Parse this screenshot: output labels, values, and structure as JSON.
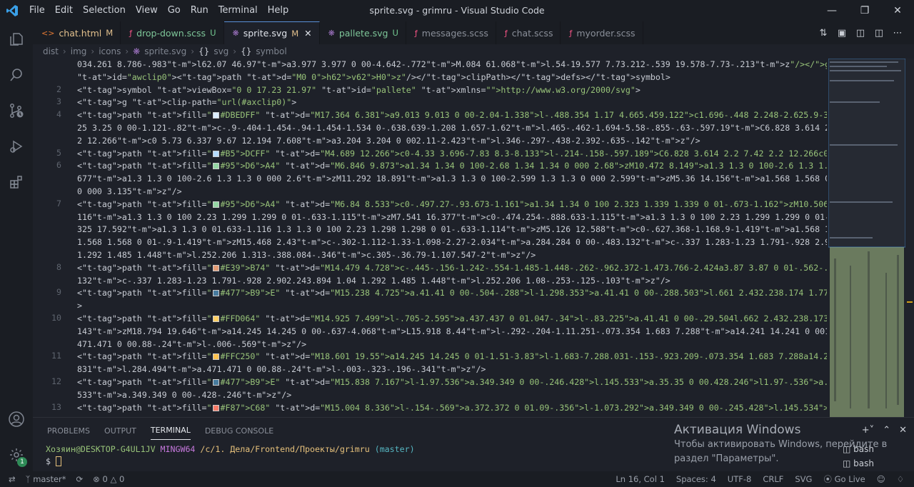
{
  "menu": [
    "File",
    "Edit",
    "Selection",
    "View",
    "Go",
    "Run",
    "Terminal",
    "Help"
  ],
  "window_title": "sprite.svg - grimru - Visual Studio Code",
  "tabs": [
    {
      "label": "chat.html",
      "status": "M",
      "icon": "html-icon",
      "color": "#e37933",
      "active": false
    },
    {
      "label": "drop-down.scss",
      "status": "U",
      "icon": "scss-icon",
      "color": "#f55385",
      "active": false
    },
    {
      "label": "sprite.svg",
      "status": "M",
      "icon": "svg-icon",
      "color": "#a074c4",
      "active": true
    },
    {
      "label": "pallete.svg",
      "status": "U",
      "icon": "svg-icon",
      "color": "#a074c4",
      "active": false
    },
    {
      "label": "messages.scss",
      "status": "",
      "icon": "scss-icon",
      "color": "#f55385",
      "active": false
    },
    {
      "label": "chat.scss",
      "status": "",
      "icon": "scss-icon",
      "color": "#f55385",
      "active": false
    },
    {
      "label": "myorder.scss",
      "status": "",
      "icon": "scss-icon",
      "color": "#f55385",
      "active": false
    }
  ],
  "breadcrumbs": [
    "dist",
    "img",
    "icons",
    "sprite.svg",
    "svg",
    "symbol"
  ],
  "line_numbers": [
    "",
    "",
    "2",
    "3",
    "4",
    "",
    "",
    "5",
    "6",
    "",
    "",
    "7",
    "",
    "",
    "",
    "",
    "8",
    "",
    "9",
    "",
    "10",
    "",
    "",
    "11",
    "",
    "12",
    "",
    "13"
  ],
  "code_lines": [
    "034.261 8.786-.983l62.07 46.97a3.977 3.977 0 00-4.642-.772M.084 61.068l.54-19.577 7.73.212-.539 19.578-7.73-.213z\"/></g></defs><clipPath",
    "id=\"awclip0\"><path d=\"M0 0h62v62H0z\"/></clipPath></defs></symbol>",
    "<symbol viewBox=\"0 0 17.23 21.97\" id=\"pallete\" xmlns=\"http://www.w3.org/2000/svg\">",
    "<g clip-path=\"url(#axclip0)\">",
    "<path fill=\"#DBEDFF\" d=\"M17.364 6.381a9.013 9.013 0 00-2.04-1.338l-.488.354 1.17 4.665.459.122c1.696-.448 2.248-2.625.9-3.803zm-1.587 8.239a3.",
    "25 3.25 0 00-1.121-.82c-.9-.404-1.454-.94-1.454-1.534 0-.638.639-1.208 1.657-1.62l.465-.462-1.694-5.58-.855-.63-.597.19C6.828 3.614 2.2 7.42 2.",
    "2 12.266c0 5.73 6.337 9.67 12.194 7.608a3.204 3.204 0 002.11-2.423l.346-.297-.438-2.392-.635-.142z\"/>",
    "<path fill=\"#B5DCFF\" d=\"M4.689 12.266c0-4.33 3.696-7.83 8.3-8.133l-.214-.158-.597.189C6.828 3.614 2.2 7.42 2.2 12.266c0 5.084 4.99 8.76 10.206",
    "<path fill=\"#95D6A4\" d=\"M6.846 9.873a1.34 1.34 0 100-2.68 1.34 1.34 0 000 2.68zM10.472 8.149a1.3 1.3 0 100-2.6 1.3 1.3 0 000 2.6zM7.507 17.",
    "677a1.3 1.3 0 100-2.6 1.3 1.3 0 000 2.6zM11.292 18.891a1.3 1.3 0 100-2.599 1.3 1.3 0 000 2.599zM5.36 14.156a1.568 1.568 0 100-3.135 1.568 1.568",
    "0 000 3.135z\"/>",
    "<path fill=\"#95D6A4\" d=\"M6.84 8.533c0-.497.27-.93.673-1.161a1.34 1.34 0 100 2.323 1.339 1.339 0 01-.673-1.162zM10.506 6.85c0-.475.254-.89.633-1",
    "116a1.3 1.3 0 100 2.23 1.299 1.299 0 01-.633-1.115zM7.541 16.377c0-.474.254-.888.633-1.115a1.3 1.3 0 100 2.23 1.299 1.299 0 01-.633-1.115zM11.",
    "325 17.592a1.3 1.3 0 01.633-1.116 1.3 1.3 0 100 2.23 1.298 1.298 0 01-.633-1.114zM5.126 12.588c0-.627.368-1.168.9-1.419a1.568 1.568 0 100 2.838",
    "1.568 1.568 0 01-.9-1.419zM15.468 2.43c-.302-1.112-1.33-1.098-2.27-2.034a.284.284 0 00-.483.132c-.337 1.283-1.23 1.791-.928 2.902.243.894 1.04",
    "1.292 1.485 1.448l.252.206 1.313-.388.084-.346c.305-.36.79-1.107.547-2z\"/>",
    "<path fill=\"#E39B74\" d=\"M14.479 4.728c-.445-.156-1.242-.554-1.485-1.448-.262-.962.372-1.473.766-2.424a3.87 3.87 0 01-.562-.46.284.284 0 00-.483",
    "132c-.337 1.283-1.23 1.791-.928 2.902.243.894 1.04 1.292 1.485 1.448l.252.206 1.08-.253-.125-.103z\"/>",
    "<path fill=\"#477B9E\" d=\"M15.238 4.725a.41.41 0 00-.504-.288l-1.298.353a.41.41 0 00-.288.503l.661 2.432.238.174 1.777-.424.075-.318-.661-2.432z\"",
    ">",
    "<path fill=\"#FFD064\" d=\"M14.925 7.499l-.705-2.595a.437.437 0 01.047-.34l-.83.225a.41.41 0 00-.29.504l.662 2.432.238.173 1.075-.256-.197-.",
    "143zM18.794 19.646a14.245 14.245 0 00-.637-4.068L15.918 8.44l-.292-.204-1.11.251-.073.354 1.683 7.288a14.241 14.241 0 001.51 3.831l.284.494a.",
    "471.471 0 00.88-.24l-.006-.569z\"/>",
    "<path fill=\"#FFC250\" d=\"M18.601 19.55a14.245 14.245 0 01-1.51-3.83l-1.683-7.288.031-.153-.923.209-.073.354 1.683 7.288a14.241 14.241 0 001.51 3",
    "831l.284.494a.471.471 0 00.88-.24l-.003-.323-.196-.341z\"/>",
    "<path fill=\"#477B9E\" d=\"M15.838 7.167l-1.97.536a.349.349 0 00-.246.428l.145.533a.35.35 0 00.428.246l1.97-.536a.349.349 0 00.246-.428l-.145-.",
    "533a.349.349 0 00-.428-.246z\"/>",
    "<path fill=\"#F87C68\" d=\"M15.004 8.336l-.154-.569a.372.372 0 01.09-.356l-1.073.292a.349.349 0 00-.245.428l.145.534a.35.35 0 00.428.245l1.114-."
  ],
  "swatches": {
    "4": "#DBEDFF",
    "7": "#B5DCFF",
    "8": "#95D6A4",
    "11": "#95D6A4",
    "16": "#E39B74",
    "18": "#477B9E",
    "20": "#FFD064",
    "23": "#FFC250",
    "25": "#477B9E",
    "27": "#F87C68"
  },
  "panel_tabs": [
    "PROBLEMS",
    "OUTPUT",
    "TERMINAL",
    "DEBUG CONSOLE"
  ],
  "terminal": {
    "user": "Хозяин@DESKTOP-G4UL1JV",
    "shell": "MINGW64",
    "path": "/c/1. Дела/Frontend/Проекты/grimru",
    "branch": "(master)",
    "prompt": "$"
  },
  "terminals": [
    "bash",
    "bash"
  ],
  "activation": {
    "title": "Активация Windows",
    "line1": "Чтобы активировать Windows, перейдите в",
    "line2": "раздел \"Параметры\"."
  },
  "status": {
    "branch": "master*",
    "errors": "0",
    "warnings": "0",
    "position": "Ln 16, Col 1",
    "spaces": "Spaces: 4",
    "encoding": "UTF-8",
    "eol": "CRLF",
    "language": "SVG",
    "golive": "Go Live"
  },
  "account_badge": "1"
}
